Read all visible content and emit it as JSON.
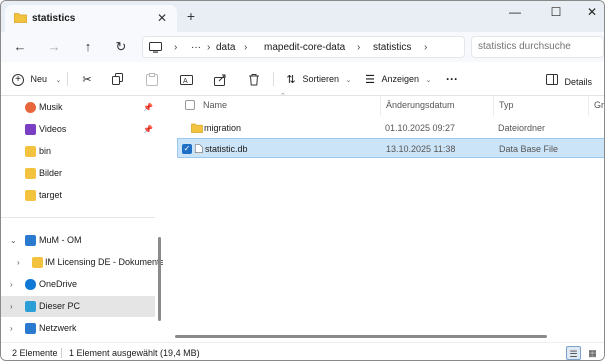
{
  "window": {
    "tab_title": "statistics",
    "new_tab_icon": "+",
    "close_tab_icon": "✕",
    "controls": {
      "minimize": "—",
      "maximize": "☐",
      "close": "✕"
    }
  },
  "nav": {
    "more_crumbs": "···",
    "breadcrumbs": [
      "data",
      "mapedit-core-data",
      "statistics"
    ],
    "search_placeholder": "statistics durchsuche"
  },
  "toolbar": {
    "new_label": "Neu",
    "sort_label": "Sortieren",
    "view_label": "Anzeigen",
    "more_label": "···",
    "details_label": "Details"
  },
  "sidebar": {
    "items": [
      {
        "label": "Musik",
        "icon": "music-icon",
        "color": "#e8663c",
        "pinned": true
      },
      {
        "label": "Videos",
        "icon": "video-icon",
        "color": "#7b3fc4",
        "pinned": true
      },
      {
        "label": "bin",
        "icon": "folder-icon",
        "color": "#f3c340",
        "pinned": false
      },
      {
        "label": "Bilder",
        "icon": "folder-icon",
        "color": "#f3c340",
        "pinned": false
      },
      {
        "label": "target",
        "icon": "folder-icon",
        "color": "#f3c340",
        "pinned": false
      },
      {
        "label": "MuM - OM",
        "icon": "building-icon",
        "color": "#2a7ad0",
        "expanded": true
      },
      {
        "label": "IM Licensing DE - Dokumente",
        "icon": "folder-icon",
        "color": "#f3c340"
      },
      {
        "label": "OneDrive",
        "icon": "cloud-icon",
        "color": "#0f78d4"
      },
      {
        "label": "Dieser PC",
        "icon": "computer-icon",
        "color": "#2a9fd6",
        "selected": true
      },
      {
        "label": "Netzwerk",
        "icon": "network-icon",
        "color": "#2a7ad0"
      }
    ]
  },
  "list": {
    "columns": {
      "name": "Name",
      "date": "Änderungsdatum",
      "type": "Typ",
      "size": "Grö"
    },
    "rows": [
      {
        "name": "migration",
        "date": "01.10.2025 09:27",
        "type": "Dateiordner",
        "icon": "folder-icon",
        "selected": false
      },
      {
        "name": "statistic.db",
        "date": "13.10.2025 11:38",
        "type": "Data Base File",
        "icon": "file-icon",
        "selected": true
      }
    ]
  },
  "status": {
    "count": "2 Elemente",
    "selection": "1 Element ausgewählt (19,4 MB)"
  }
}
